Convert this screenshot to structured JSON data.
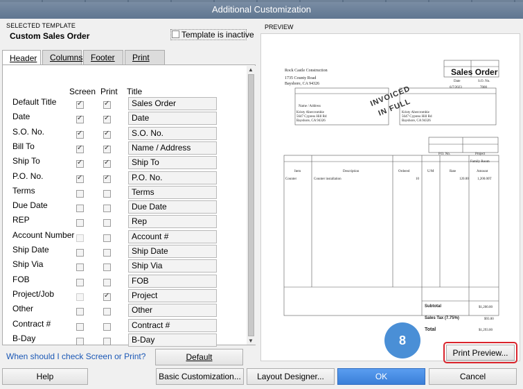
{
  "window": {
    "title": "Additional Customization"
  },
  "selected_template": {
    "section_label": "SELECTED TEMPLATE",
    "name": "Custom Sales Order",
    "inactive_label": "Template is inactive"
  },
  "tabs": [
    {
      "label": "Header"
    },
    {
      "label": "Columns"
    },
    {
      "label": "Footer"
    },
    {
      "label": "Print"
    }
  ],
  "columns": {
    "screen": "Screen",
    "print": "Print",
    "title": "Title"
  },
  "rows": [
    {
      "label": "Default Title",
      "screen": true,
      "print": true,
      "title": "Sales Order"
    },
    {
      "label": "Date",
      "screen": true,
      "print": true,
      "title": "Date"
    },
    {
      "label": "S.O. No.",
      "screen": true,
      "print": true,
      "title": "S.O. No."
    },
    {
      "label": "Bill To",
      "screen": true,
      "print": true,
      "title": "Name / Address"
    },
    {
      "label": "Ship To",
      "screen": true,
      "print": true,
      "title": "Ship To"
    },
    {
      "label": "P.O. No.",
      "screen": true,
      "print": true,
      "title": "P.O. No."
    },
    {
      "label": "Terms",
      "screen": false,
      "print": false,
      "title": "Terms"
    },
    {
      "label": "Due Date",
      "screen": false,
      "print": false,
      "title": "Due Date"
    },
    {
      "label": "REP",
      "screen": false,
      "print": false,
      "title": "Rep"
    },
    {
      "label": "Account Number",
      "screen": false,
      "print": false,
      "title": "Account #",
      "screen_disabled": true
    },
    {
      "label": "Ship Date",
      "screen": false,
      "print": false,
      "title": "Ship Date"
    },
    {
      "label": "Ship Via",
      "screen": false,
      "print": false,
      "title": "Ship Via"
    },
    {
      "label": "FOB",
      "screen": false,
      "print": false,
      "title": "FOB"
    },
    {
      "label": "Project/Job",
      "screen": false,
      "print": true,
      "title": "Project",
      "screen_disabled": true
    },
    {
      "label": "Other",
      "screen": false,
      "print": false,
      "title": "Other"
    },
    {
      "label": "Contract #",
      "screen": false,
      "print": false,
      "title": "Contract #"
    },
    {
      "label": "B-Day",
      "screen": false,
      "print": false,
      "title": "B-Day"
    }
  ],
  "help_link": "When should I check Screen or Print?",
  "default_button": "Default",
  "preview": {
    "section_label": "PREVIEW",
    "company_name": "Rock Castle Construction",
    "company_addr1": "1735 County Road",
    "company_addr2": "Bayshore, CA 94326",
    "doc_title": "Sales Order",
    "date_label": "Date",
    "so_label": "S.O. No.",
    "date_value": "6/7/2023",
    "so_value": "7000",
    "stamp1": "INVOICED",
    "stamp2": "IN FULL",
    "name_addr_label": "Name / Address",
    "bill_lines": [
      "Kristy Abercrombie",
      "5647 Cypress Hill Rd",
      "Bayshore, CA 94326"
    ],
    "ship_lines": [
      "Kristy Abercrombie",
      "5647 Cypress Hill Rd",
      "Bayshore, CA 94326"
    ],
    "po_label": "P.O. No.",
    "project_label": "Project",
    "project_value": "Family Room",
    "table_headers": [
      "Item",
      "Description",
      "Ordered",
      "U/M",
      "Rate",
      "Amount"
    ],
    "line_item": [
      "Counter",
      "Counter installation",
      "10",
      "",
      "120.00",
      "1,200.00T"
    ],
    "subtotal_label": "Subtotal",
    "subtotal_value": "$1,200.00",
    "tax_label": "Sales Tax  (7.75%)",
    "tax_value": "$93.00",
    "total_label": "Total",
    "total_value": "$1,293.00"
  },
  "step_badge": "8",
  "print_preview_button": "Print Preview...",
  "buttons": {
    "help": "Help",
    "basic": "Basic Customization...",
    "layout": "Layout Designer...",
    "ok": "OK",
    "cancel": "Cancel"
  }
}
